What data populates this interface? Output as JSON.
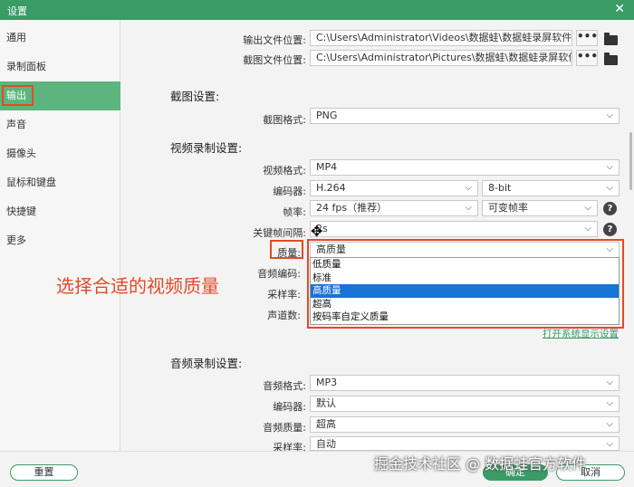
{
  "window": {
    "title": "设置",
    "close_glyph": "✕"
  },
  "sidebar": {
    "items": [
      {
        "label": "通用"
      },
      {
        "label": "录制面板"
      },
      {
        "label": "输出"
      },
      {
        "label": "声音"
      },
      {
        "label": "摄像头"
      },
      {
        "label": "鼠标和键盘"
      },
      {
        "label": "快捷键"
      },
      {
        "label": "更多"
      }
    ],
    "active_index": 2
  },
  "output": {
    "video_path_label": "输出文件位置:",
    "video_path_value": "C:\\Users\\Administrator\\Videos\\数据蛙\\数据蛙录屏软件",
    "screenshot_path_label": "截图文件位置:",
    "screenshot_path_value": "C:\\Users\\Administrator\\Pictures\\数据蛙\\数据蛙录屏软件",
    "browse_label": "•••"
  },
  "screenshot_settings": {
    "heading": "截图设置:",
    "format_label": "截图格式:",
    "format_value": "PNG"
  },
  "video_settings": {
    "heading": "视频录制设置:",
    "format_label": "视频格式:",
    "format_value": "MP4",
    "encoder_label": "编码器:",
    "encoder_value": "H.264",
    "bitdepth_value": "8-bit",
    "fps_label": "帧率:",
    "fps_value": "24 fps（推荐）",
    "fps_mode_value": "可变帧率",
    "keyframe_label": "关键帧间隔:",
    "keyframe_value": "2s",
    "quality_label": "质量:",
    "quality_value": "高质量",
    "audio_codec_label": "音频编码:",
    "samplerate_label": "采样率:",
    "channels_label": "声道数:",
    "quality_options": [
      "低质量",
      "标准",
      "高质量",
      "超高",
      "按码率自定义质量"
    ],
    "quality_selected_index": 2,
    "open_system_display_link": "打开系统显示设置"
  },
  "audio_settings": {
    "heading": "音频录制设置:",
    "format_label": "音频格式:",
    "format_value": "MP3",
    "encoder_label": "编码器:",
    "encoder_value": "默认",
    "quality_label": "音频质量:",
    "quality_value": "超高",
    "samplerate_label": "采样率:",
    "samplerate_value": "自动"
  },
  "annotation": {
    "text": "选择合适的视频质量"
  },
  "footer": {
    "reset_label": "重置",
    "ok_label": "确定",
    "cancel_label": "取消",
    "watermark": "掘金技术社区 @ 数据蛙官方软件"
  },
  "icons": {
    "chevron": "⌵",
    "help": "?",
    "cursor": "✥"
  },
  "colors": {
    "brand": "#3a9b67",
    "sidebar_active": "#5cb57f",
    "highlight": "#e24b26",
    "selected_option": "#1874d6"
  }
}
